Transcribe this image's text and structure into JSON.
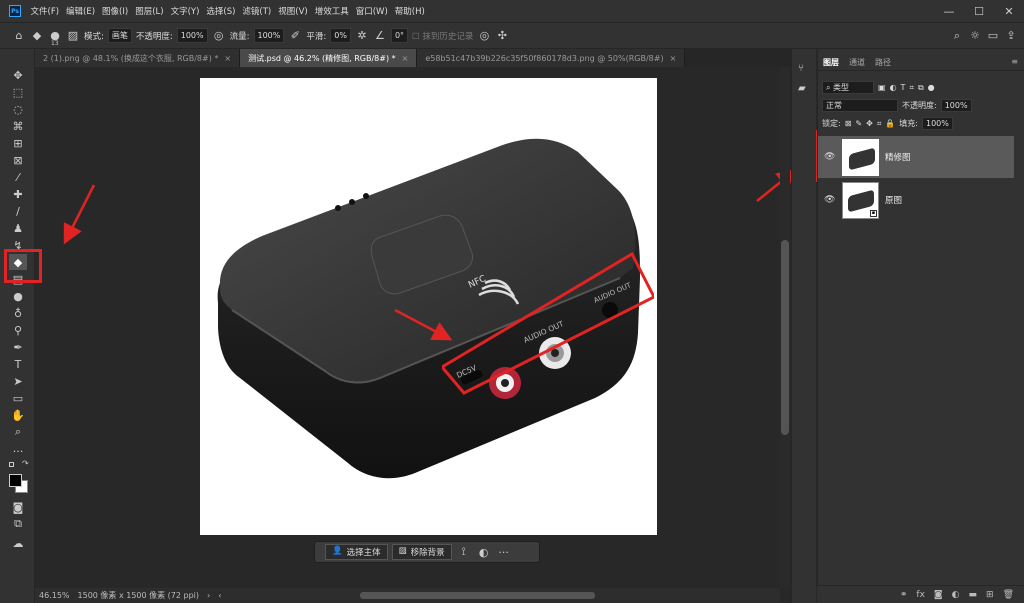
{
  "menubar": {
    "logo": "Ps",
    "items": [
      "文件(F)",
      "编辑(E)",
      "图像(I)",
      "图层(L)",
      "文字(Y)",
      "选择(S)",
      "滤镜(T)",
      "视图(V)",
      "增效工具",
      "窗口(W)",
      "帮助(H)"
    ],
    "win_minimize": "—",
    "win_maximize": "☐",
    "win_close": "✕"
  },
  "options": {
    "brush_size": "13",
    "mode_label": "模式:",
    "mode_value": "画笔",
    "opacity_label": "不透明度:",
    "opacity_value": "100%",
    "flow_label": "流量:",
    "flow_value": "100%",
    "smooth_label": "平滑:",
    "smooth_value": "0%",
    "angle_value": "0°",
    "history_label": "抹到历史记录"
  },
  "tabs": [
    {
      "label": "2 (1).png @ 48.1% (换成这个衣服, RGB/8#) *",
      "close": "×"
    },
    {
      "label": "测试.psd @ 46.2% (精修图, RGB/8#) *",
      "close": "×"
    },
    {
      "label": "e58b51c47b39b226c35f50f860178d3.png @ 50%(RGB/8#)",
      "close": "×"
    }
  ],
  "context_bar": {
    "select_subject": "选择主体",
    "remove_bg": "移除背景",
    "more": "···"
  },
  "status": {
    "zoom": "46.15%",
    "doc_info": "1500 像素 x 1500 像素 (72 ppi)"
  },
  "panel": {
    "tabs": [
      "图层",
      "通道",
      "路径"
    ],
    "filter_kind": "类型",
    "blend_mode": "正常",
    "opacity_label": "不透明度:",
    "opacity_value": "100%",
    "lock_label": "锁定:",
    "fill_label": "填充:",
    "fill_value": "100%",
    "layers": [
      {
        "name": "精修图",
        "selected": true
      },
      {
        "name": "原图",
        "selected": false
      }
    ]
  },
  "product": {
    "nfc": "NFC",
    "dc": "DC5V",
    "audio_out_1": "AUDIO OUT",
    "audio_out_2": "AUDIO OUT"
  },
  "colors": {
    "highlight": "#e12323",
    "ui_bg": "#323232"
  }
}
